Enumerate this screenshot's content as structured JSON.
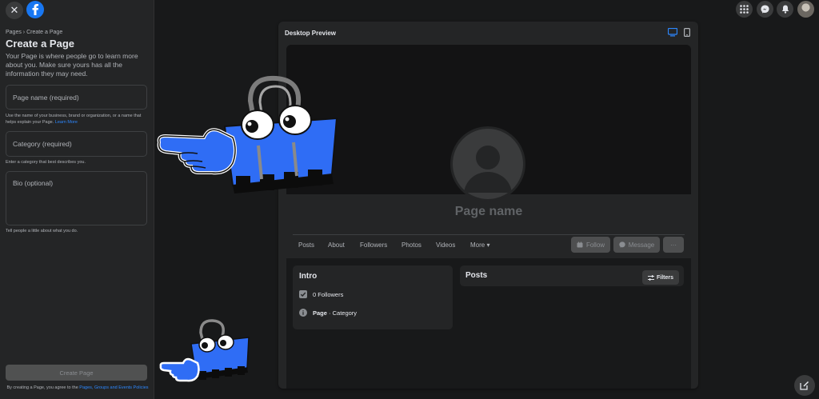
{
  "sidebar": {
    "breadcrumb": "Pages › Create a Page",
    "title": "Create a Page",
    "description": "Your Page is where people go to learn more about you. Make sure yours has all the information they may need.",
    "page_name_placeholder": "Page name (required)",
    "page_name_help": "Use the name of your business, brand or organization, or a name that helps explain your Page.",
    "learn_more": "Learn More",
    "category_placeholder": "Category (required)",
    "category_help": "Enter a category that best describes you.",
    "bio_placeholder": "Bio (optional)",
    "bio_help": "Tell people a little about what you do.",
    "create_button": "Create Page",
    "terms_prefix": "By creating a Page, you agree to the",
    "terms_link": "Pages, Groups and Events Policies"
  },
  "preview": {
    "title": "Desktop Preview",
    "page_name": "Page name",
    "tabs": [
      "Posts",
      "About",
      "Followers",
      "Photos",
      "Videos",
      "More ▾"
    ],
    "follow_button": "Follow",
    "message_button": "Message",
    "more_button": "···",
    "intro_title": "Intro",
    "followers_text": "0 Followers",
    "page_label": "Page",
    "category_label": " · Category",
    "posts_title": "Posts",
    "filters_button": "Filters"
  },
  "colors": {
    "accent": "#1877f2",
    "link": "#2d88ff",
    "mascot_blue": "#2f6df5"
  }
}
